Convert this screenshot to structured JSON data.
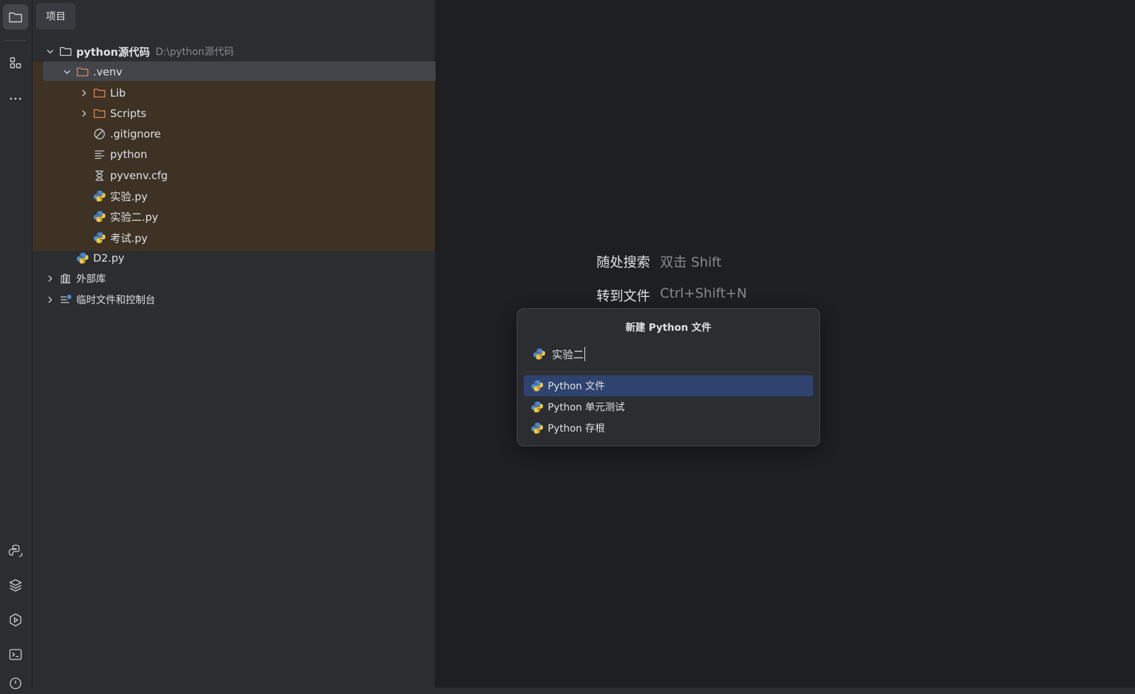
{
  "toolstrip": {
    "top_tools": [
      "project-folder-icon",
      "structure-icon",
      "more-icon"
    ],
    "bottom_tools": [
      "python-console-icon",
      "layers-icon",
      "services-icon",
      "terminal-icon",
      "problems-icon"
    ]
  },
  "project_panel": {
    "tab_label": "项目",
    "tree": [
      {
        "label": "python源代码",
        "hint": "D:\\python源代码",
        "icon": "folder-icon",
        "bold": true
      },
      {
        "label": ".venv",
        "icon": "folder-icon",
        "selected": true
      },
      {
        "label": "Lib",
        "icon": "folder-icon"
      },
      {
        "label": "Scripts",
        "icon": "folder-icon"
      },
      {
        "label": ".gitignore",
        "icon": "ignored-file-icon"
      },
      {
        "label": "python",
        "icon": "text-file-icon"
      },
      {
        "label": "pyvenv.cfg",
        "icon": "config-file-icon"
      },
      {
        "label": "实验.py",
        "icon": "python-file-icon"
      },
      {
        "label": "实验二.py",
        "icon": "python-file-icon"
      },
      {
        "label": "考试.py",
        "icon": "python-file-icon"
      },
      {
        "label": "D2.py",
        "icon": "python-file-icon"
      },
      {
        "label": "外部库",
        "icon": "library-icon"
      },
      {
        "label": "临时文件和控制台",
        "icon": "scratch-icon"
      }
    ]
  },
  "editor": {
    "hints": [
      {
        "action": "随处搜索",
        "shortcut": "双击 Shift"
      },
      {
        "action": "转到文件",
        "shortcut": "Ctrl+Shift+N"
      }
    ]
  },
  "new_file_popup": {
    "title": "新建 Python 文件",
    "input_value": "实验二",
    "options": [
      {
        "label": "Python 文件",
        "selected": true
      },
      {
        "label": "Python 单元测试",
        "selected": false
      },
      {
        "label": "Python 存根",
        "selected": false
      }
    ]
  },
  "colors": {
    "accent_selection": "#2e436e",
    "venv_highlight": "#3d3223",
    "folder_orange": "#e08855",
    "python_blue": "#4a8ad4",
    "python_yellow": "#f5c842"
  }
}
